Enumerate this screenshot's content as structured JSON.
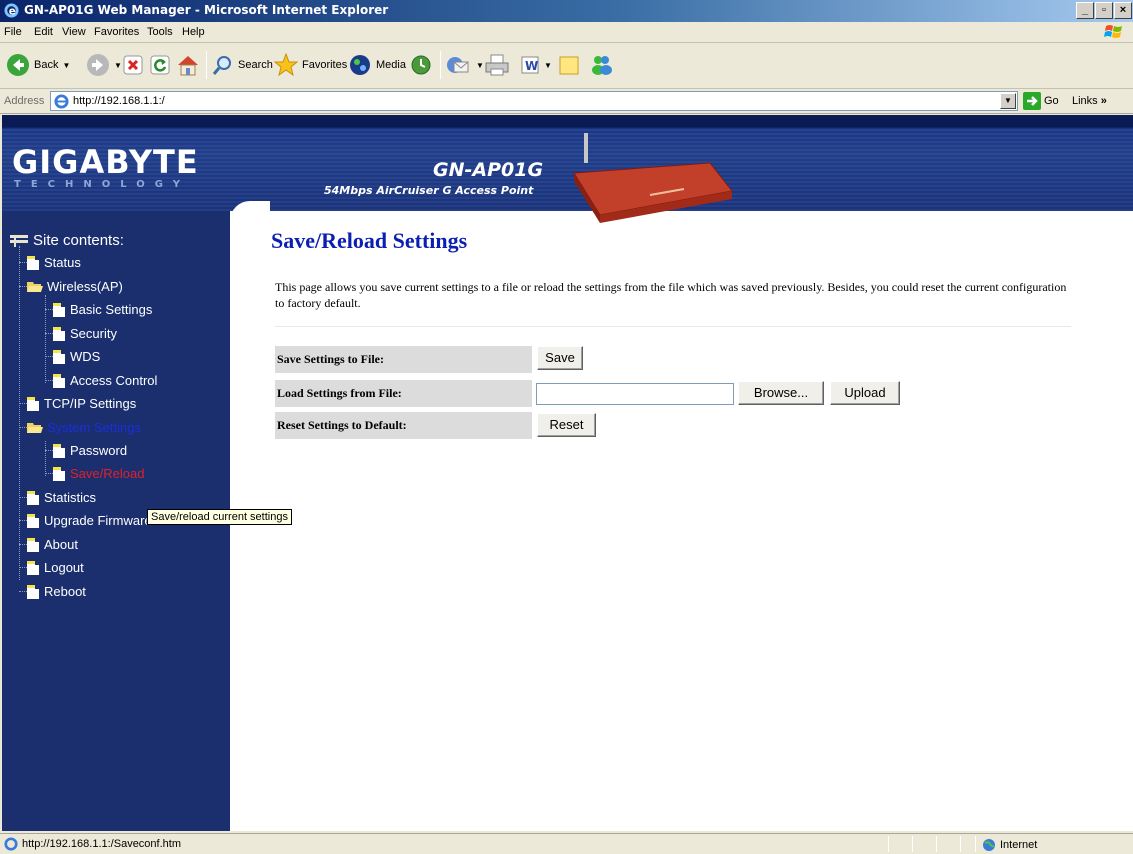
{
  "window": {
    "title": "GN-AP01G Web Manager - Microsoft Internet Explorer"
  },
  "menu": [
    "File",
    "Edit",
    "View",
    "Favorites",
    "Tools",
    "Help"
  ],
  "toolbar": {
    "back": "Back",
    "search": "Search",
    "favorites": "Favorites",
    "media": "Media"
  },
  "address": {
    "label": "Address",
    "url": "http://192.168.1.1:/",
    "go": "Go",
    "links": "Links"
  },
  "banner": {
    "brand": "GIGABYTE",
    "brand_sub": "TECHNOLOGY",
    "model": "GN-AP01G",
    "model_sub": "54Mbps AirCruiser G Access Point"
  },
  "sidebar": {
    "header": "Site contents:",
    "items": [
      {
        "label": "Status"
      },
      {
        "label": "Wireless(AP)"
      },
      {
        "label": "Basic Settings"
      },
      {
        "label": "Security"
      },
      {
        "label": "WDS"
      },
      {
        "label": "Access Control"
      },
      {
        "label": "TCP/IP Settings"
      },
      {
        "label": "System Settings"
      },
      {
        "label": "Password"
      },
      {
        "label": "Save/Reload"
      },
      {
        "label": "Statistics"
      },
      {
        "label": "Upgrade Firmware"
      },
      {
        "label": "About"
      },
      {
        "label": "Logout"
      },
      {
        "label": "Reboot"
      }
    ],
    "active_color": "#e0202a"
  },
  "tooltip": "Save/reload current settings",
  "main": {
    "title": "Save/Reload Settings",
    "description": "This page allows you save current settings to a file or reload the settings from the file which was saved previously. Besides, you could reset the current configuration to factory default.",
    "rows": [
      {
        "label": "Save Settings to File:",
        "button": "Save"
      },
      {
        "label": "Load Settings from File:",
        "browse": "Browse...",
        "button": "Upload",
        "file_value": ""
      },
      {
        "label": "Reset Settings to Default:",
        "button": "Reset"
      }
    ]
  },
  "status": {
    "text": "http://192.168.1.1:/Saveconf.htm",
    "zone": "Internet"
  }
}
